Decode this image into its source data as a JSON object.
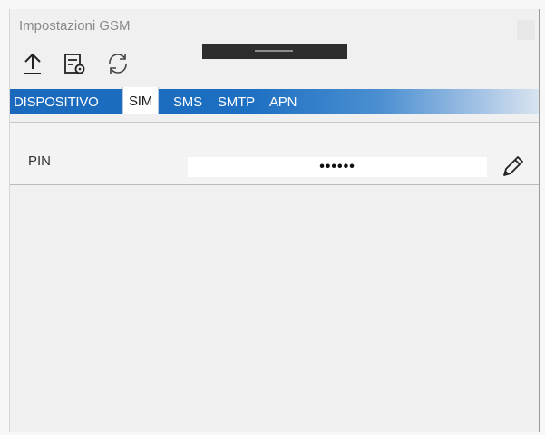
{
  "window": {
    "title": "Impostazioni GSM"
  },
  "toolbar": {
    "icons": [
      "upload-icon",
      "settings-list-icon",
      "refresh-icon"
    ]
  },
  "tabs": [
    {
      "label": "DISPOSITIVO",
      "active": false
    },
    {
      "label": "SIM",
      "active": true
    },
    {
      "label": "SMS",
      "active": false
    },
    {
      "label": "SMTP",
      "active": false
    },
    {
      "label": "APN",
      "active": false
    }
  ],
  "sim": {
    "pin_label": "PIN",
    "pin_value": "••••••",
    "edit_icon": "pencil-icon"
  },
  "colors": {
    "tab_bar": "#1a69bd",
    "window_bg": "#f0f0f0"
  }
}
